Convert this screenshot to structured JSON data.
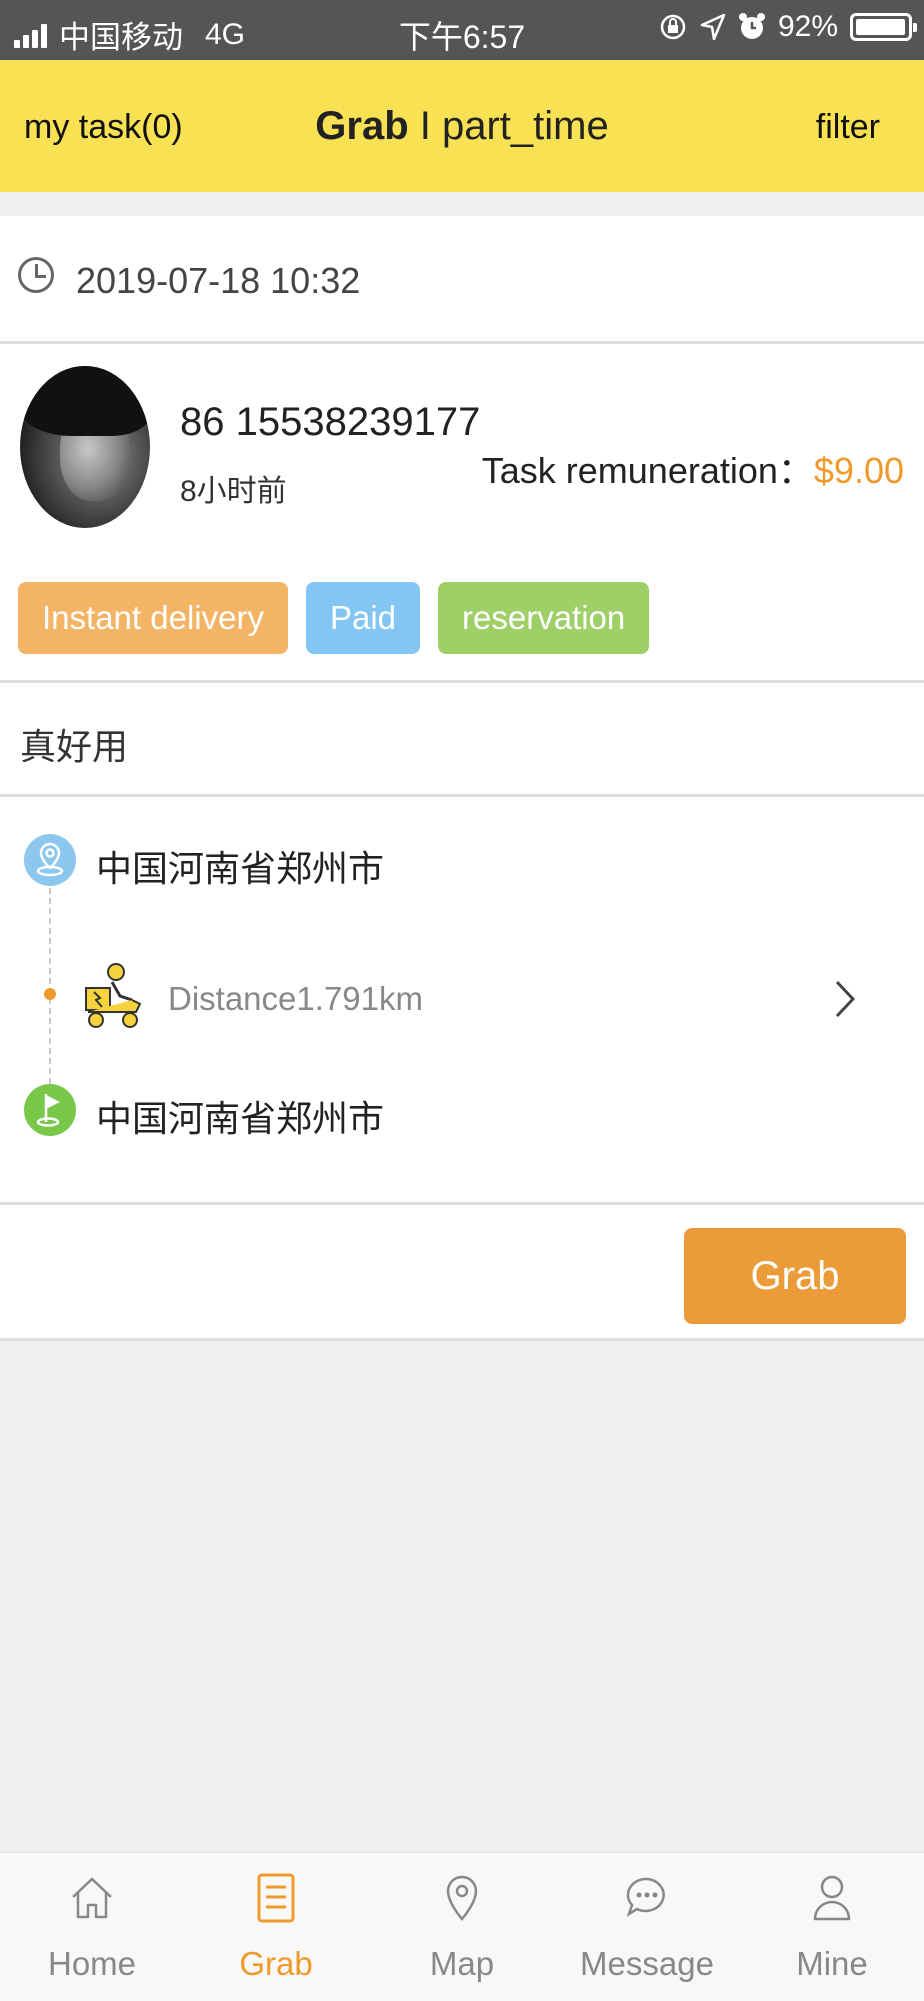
{
  "status_bar": {
    "carrier": "中国移动",
    "network": "4G",
    "time": "下午6:57",
    "battery": "92%"
  },
  "navbar": {
    "left": "my task(0)",
    "title_bold": "Grab",
    "title_sep": " I ",
    "title_rest": "part_time",
    "right": "filter"
  },
  "task": {
    "datetime": "2019-07-18 10:32",
    "phone": "86 15538239177",
    "posted_ago": "8小时前",
    "remuneration_label": "Task remuneration：",
    "remuneration_value": "$9.00",
    "tags": [
      "Instant delivery",
      "Paid",
      "reservation"
    ],
    "note": "真好用",
    "start_address": "中国河南省郑州市",
    "distance": "Distance1.791km",
    "end_address": "中国河南省郑州市",
    "grab_button": "Grab"
  },
  "colors": {
    "accent": "#f09a2b",
    "navbar": "#f8e152",
    "tag_orange": "#f3b465",
    "tag_blue": "#83c6f3",
    "tag_green": "#9fd068"
  },
  "tabbar": {
    "items": [
      {
        "label": "Home",
        "icon": "home-icon"
      },
      {
        "label": "Grab",
        "icon": "document-icon"
      },
      {
        "label": "Map",
        "icon": "map-pin-icon"
      },
      {
        "label": "Message",
        "icon": "chat-bubble-icon"
      },
      {
        "label": "Mine",
        "icon": "person-icon"
      }
    ],
    "active": "Grab"
  }
}
